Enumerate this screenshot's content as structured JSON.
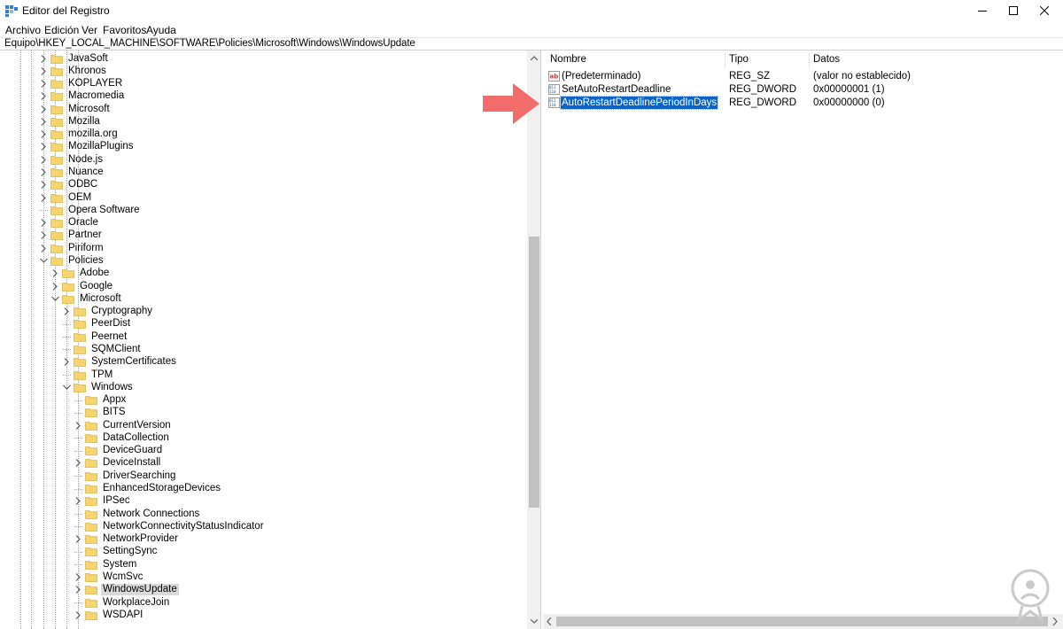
{
  "window": {
    "title": "Editor del Registro"
  },
  "menu": [
    "Archivo",
    "Edición",
    "Ver",
    "Favoritos",
    "Ayuda"
  ],
  "address": "Equipo\\HKEY_LOCAL_MACHINE\\SOFTWARE\\Policies\\Microsoft\\Windows\\WindowsUpdate",
  "tree": {
    "items": [
      {
        "label": "JavaSoft",
        "level": 0,
        "expander": "collapsed"
      },
      {
        "label": "Khronos",
        "level": 0,
        "expander": "collapsed"
      },
      {
        "label": "KOPLAYER",
        "level": 0,
        "expander": "collapsed"
      },
      {
        "label": "Macromedia",
        "level": 0,
        "expander": "collapsed"
      },
      {
        "label": "Microsoft",
        "level": 0,
        "expander": "collapsed"
      },
      {
        "label": "Mozilla",
        "level": 0,
        "expander": "collapsed"
      },
      {
        "label": "mozilla.org",
        "level": 0,
        "expander": "collapsed"
      },
      {
        "label": "MozillaPlugins",
        "level": 0,
        "expander": "collapsed"
      },
      {
        "label": "Node.js",
        "level": 0,
        "expander": "collapsed"
      },
      {
        "label": "Nuance",
        "level": 0,
        "expander": "collapsed"
      },
      {
        "label": "ODBC",
        "level": 0,
        "expander": "collapsed"
      },
      {
        "label": "OEM",
        "level": 0,
        "expander": "collapsed"
      },
      {
        "label": "Opera Software",
        "level": 0,
        "expander": "none"
      },
      {
        "label": "Oracle",
        "level": 0,
        "expander": "collapsed"
      },
      {
        "label": "Partner",
        "level": 0,
        "expander": "collapsed"
      },
      {
        "label": "Piriform",
        "level": 0,
        "expander": "collapsed"
      },
      {
        "label": "Policies",
        "level": 0,
        "expander": "expanded"
      },
      {
        "label": "Adobe",
        "level": 1,
        "expander": "collapsed"
      },
      {
        "label": "Google",
        "level": 1,
        "expander": "collapsed"
      },
      {
        "label": "Microsoft",
        "level": 1,
        "expander": "expanded"
      },
      {
        "label": "Cryptography",
        "level": 2,
        "expander": "collapsed"
      },
      {
        "label": "PeerDist",
        "level": 2,
        "expander": "none"
      },
      {
        "label": "Peernet",
        "level": 2,
        "expander": "none"
      },
      {
        "label": "SQMClient",
        "level": 2,
        "expander": "none"
      },
      {
        "label": "SystemCertificates",
        "level": 2,
        "expander": "collapsed"
      },
      {
        "label": "TPM",
        "level": 2,
        "expander": "none"
      },
      {
        "label": "Windows",
        "level": 2,
        "expander": "expanded"
      },
      {
        "label": "Appx",
        "level": 3,
        "expander": "none"
      },
      {
        "label": "BITS",
        "level": 3,
        "expander": "none"
      },
      {
        "label": "CurrentVersion",
        "level": 3,
        "expander": "collapsed"
      },
      {
        "label": "DataCollection",
        "level": 3,
        "expander": "none"
      },
      {
        "label": "DeviceGuard",
        "level": 3,
        "expander": "none"
      },
      {
        "label": "DeviceInstall",
        "level": 3,
        "expander": "collapsed"
      },
      {
        "label": "DriverSearching",
        "level": 3,
        "expander": "none"
      },
      {
        "label": "EnhancedStorageDevices",
        "level": 3,
        "expander": "none"
      },
      {
        "label": "IPSec",
        "level": 3,
        "expander": "collapsed"
      },
      {
        "label": "Network Connections",
        "level": 3,
        "expander": "none"
      },
      {
        "label": "NetworkConnectivityStatusIndicator",
        "level": 3,
        "expander": "none"
      },
      {
        "label": "NetworkProvider",
        "level": 3,
        "expander": "collapsed"
      },
      {
        "label": "SettingSync",
        "level": 3,
        "expander": "none"
      },
      {
        "label": "System",
        "level": 3,
        "expander": "none"
      },
      {
        "label": "WcmSvc",
        "level": 3,
        "expander": "collapsed"
      },
      {
        "label": "WindowsUpdate",
        "level": 3,
        "expander": "collapsed",
        "selected": true
      },
      {
        "label": "WorkplaceJoin",
        "level": 3,
        "expander": "none"
      },
      {
        "label": "WSDAPI",
        "level": 3,
        "expander": "collapsed"
      }
    ]
  },
  "list": {
    "columns": {
      "name": "Nombre",
      "type": "Tipo",
      "data": "Datos"
    },
    "rows": [
      {
        "name": "(Predeterminado)",
        "type": "REG_SZ",
        "data": "(valor no establecido)",
        "icon": "string-value-icon"
      },
      {
        "name": "SetAutoRestartDeadline",
        "type": "REG_DWORD",
        "data": "0x00000001 (1)",
        "icon": "dword-value-icon"
      },
      {
        "name": "AutoRestartDeadlinePeriodInDays",
        "type": "REG_DWORD",
        "data": "0x00000000 (0)",
        "icon": "dword-value-icon",
        "selected": true
      }
    ]
  },
  "colors": {
    "accent_arrow": "#f26c6c",
    "selection": "#0a63c9",
    "folder": "#f7d56e"
  }
}
